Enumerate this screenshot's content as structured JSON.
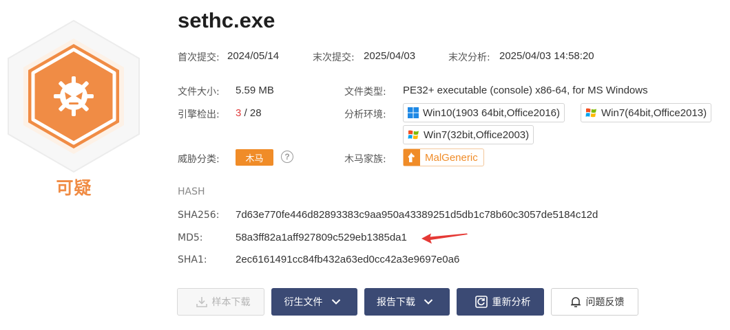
{
  "file": {
    "name": "sethc.exe",
    "verdict": "可疑"
  },
  "dates": {
    "first_submit_label": "首次提交:",
    "first_submit": "2024/05/14",
    "last_submit_label": "末次提交:",
    "last_submit": "2025/04/03",
    "last_analysis_label": "末次分析:",
    "last_analysis": "2025/04/03 14:58:20"
  },
  "details": {
    "size_label": "文件大小:",
    "size": "5.59 MB",
    "type_label": "文件类型:",
    "type": "PE32+ executable (console) x86-64, for MS Windows",
    "engines_label": "引擎检出:",
    "engines_detected": "3",
    "engines_total": "/ 28",
    "env_label": "分析环境:",
    "environments": [
      "Win10(1903 64bit,Office2016)",
      "Win7(64bit,Office2013)",
      "Win7(32bit,Office2003)"
    ],
    "threat_label": "威胁分类:",
    "threat": "木马",
    "family_label": "木马家族:",
    "family": "MalGeneric"
  },
  "hash": {
    "heading": "HASH",
    "sha256_label": "SHA256:",
    "sha256": "7d63e770fe446d82893383c9aa950a43389251d5db1c78b60c3057de5184c12d",
    "md5_label": "MD5:",
    "md5": "58a3ff82a1aff927809c529eb1385da1",
    "sha1_label": "SHA1:",
    "sha1": "2ec6161491cc84fb432a63ed0cc42a3e9697e0a6"
  },
  "actions": {
    "sample_download": "样本下载",
    "derived_files": "衍生文件",
    "report_download": "报告下载",
    "reanalyze": "重新分析",
    "feedback": "问题反馈"
  },
  "colors": {
    "accent": "#f08c28",
    "badge": "#f08c45",
    "button_dark": "#3b4a74",
    "detected": "#e03c3c",
    "arrow": "#e53935"
  }
}
